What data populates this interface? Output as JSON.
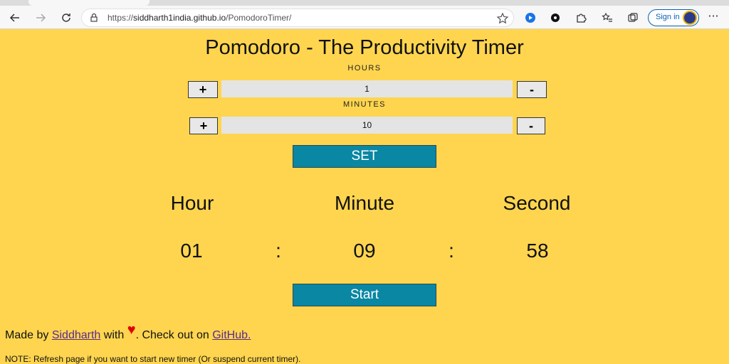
{
  "browser": {
    "url_prefix": "https://",
    "url_host": "siddharth1india.github.io",
    "url_path": "/PomodoroTimer/",
    "signin_label": "Sign in",
    "more_label": "···"
  },
  "page": {
    "title": "Pomodoro - The Productivity Timer",
    "hours_caption": "HOURS",
    "minutes_caption": "MINUTES",
    "plus_label": "+",
    "minus_label": "-",
    "hours_value": "1",
    "minutes_value": "10",
    "set_label": "SET",
    "col_hour": "Hour",
    "col_minute": "Minute",
    "col_second": "Second",
    "hour_digits": "01",
    "minute_digits": "09",
    "second_digits": "58",
    "colon": ":",
    "start_label": "Start"
  },
  "footer": {
    "made_by": "Made by",
    "author_link": "Siddharth",
    "with": "with",
    "heart": "♥",
    "check_out": ". Check out on",
    "github_link": "GitHub.",
    "note": "NOTE: Refresh page if you want to start new timer (Or suspend current timer)."
  },
  "colors": {
    "background": "#ffd54f",
    "button": "#0a87a3",
    "heart": "#e00000"
  }
}
